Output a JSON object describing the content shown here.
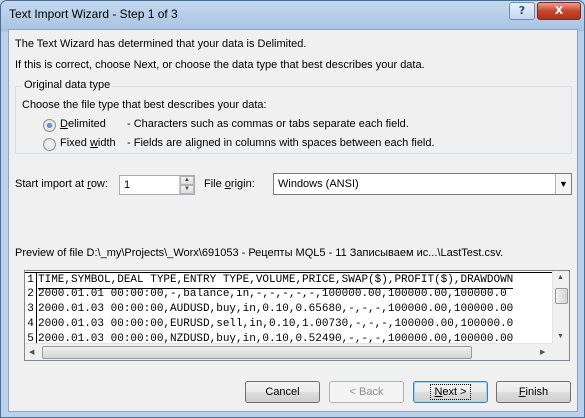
{
  "window": {
    "title": "Text Import Wizard - Step 1 of 3",
    "help_label": "?",
    "close_label": "X"
  },
  "intro": {
    "line1": "The Text Wizard has determined that your data is Delimited.",
    "line2": "If this is correct, choose Next, or choose the data type that best describes your data."
  },
  "data_type": {
    "legend": "Original data type",
    "prompt": "Choose the file type that best describes your data:",
    "options": [
      {
        "label_pre": "",
        "label_ul": "D",
        "label_post": "elimited",
        "description": "- Characters such as commas or tabs separate each field.",
        "selected": true
      },
      {
        "label_pre": "Fixed ",
        "label_ul": "w",
        "label_post": "idth",
        "description": "- Fields are aligned in columns with spaces between each field.",
        "selected": false
      }
    ]
  },
  "start_import": {
    "label_pre": "Start import at ",
    "label_ul": "r",
    "label_post": "ow:",
    "value": "1"
  },
  "file_origin": {
    "label_pre": "File ",
    "label_ul": "o",
    "label_post": "rigin:",
    "value": "Windows (ANSI)"
  },
  "preview": {
    "label": "Preview of file D:\\_my\\Projects\\_Worx\\691053 - Рецепты MQL5 - 11 Записываем ис...\\LastTest.csv.",
    "rows": [
      {
        "num": "1",
        "text": "TIME,SYMBOL,DEAL TYPE,ENTRY TYPE,VOLUME,PRICE,SWAP($),PROFIT($),DRAWDOWN"
      },
      {
        "num": "2",
        "text": "2000.01.01 00:00:00,-,balance,in,-,-,-,-,-,100000.00,100000.00,100000.0"
      },
      {
        "num": "3",
        "text": "2000.01.03 00:00:00,AUDUSD,buy,in,0.10,0.65680,-,-,-,100000.00,100000.00"
      },
      {
        "num": "4",
        "text": "2000.01.03 00:00:00,EURUSD,sell,in,0.10,1.00730,-,-,-,100000.00,100000.0"
      },
      {
        "num": "5",
        "text": "2000.01.03 00:00:00,NZDUSD,buy,in,0.10,0.52490,-,-,-,100000.00,100000.00"
      }
    ]
  },
  "buttons": {
    "cancel": "Cancel",
    "back": "< Back",
    "next_ul": "N",
    "next_post": "ext >",
    "finish_ul": "F",
    "finish_post": "inish"
  },
  "colors": {
    "accent": "#3c7fb1",
    "title_bar": "#b9d1ea",
    "close_button": "#c7452d"
  }
}
